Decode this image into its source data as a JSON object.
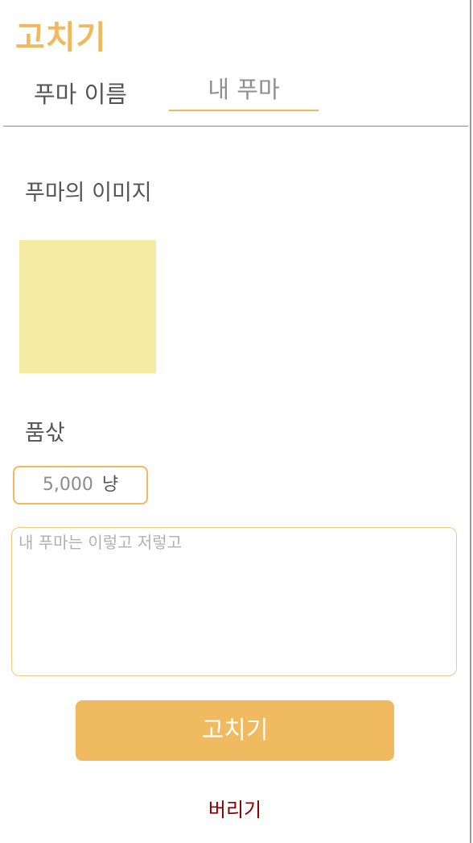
{
  "app": {
    "title": "고치기"
  },
  "tabs": {
    "name_label": "푸마 이름",
    "mine_label": "내 푸마"
  },
  "form": {
    "image_label": "푸마의 이미지",
    "price_label": "품삯",
    "price_value": "5,000",
    "price_unit": "냥",
    "description_placeholder": "내 푸마는 이렇고 저렇고"
  },
  "actions": {
    "save_label": "고치기",
    "delete_label": "버리기"
  },
  "colors": {
    "accent": "#f0bb60",
    "image_placeholder": "#f5eca3",
    "delete_text": "#8b0000"
  }
}
